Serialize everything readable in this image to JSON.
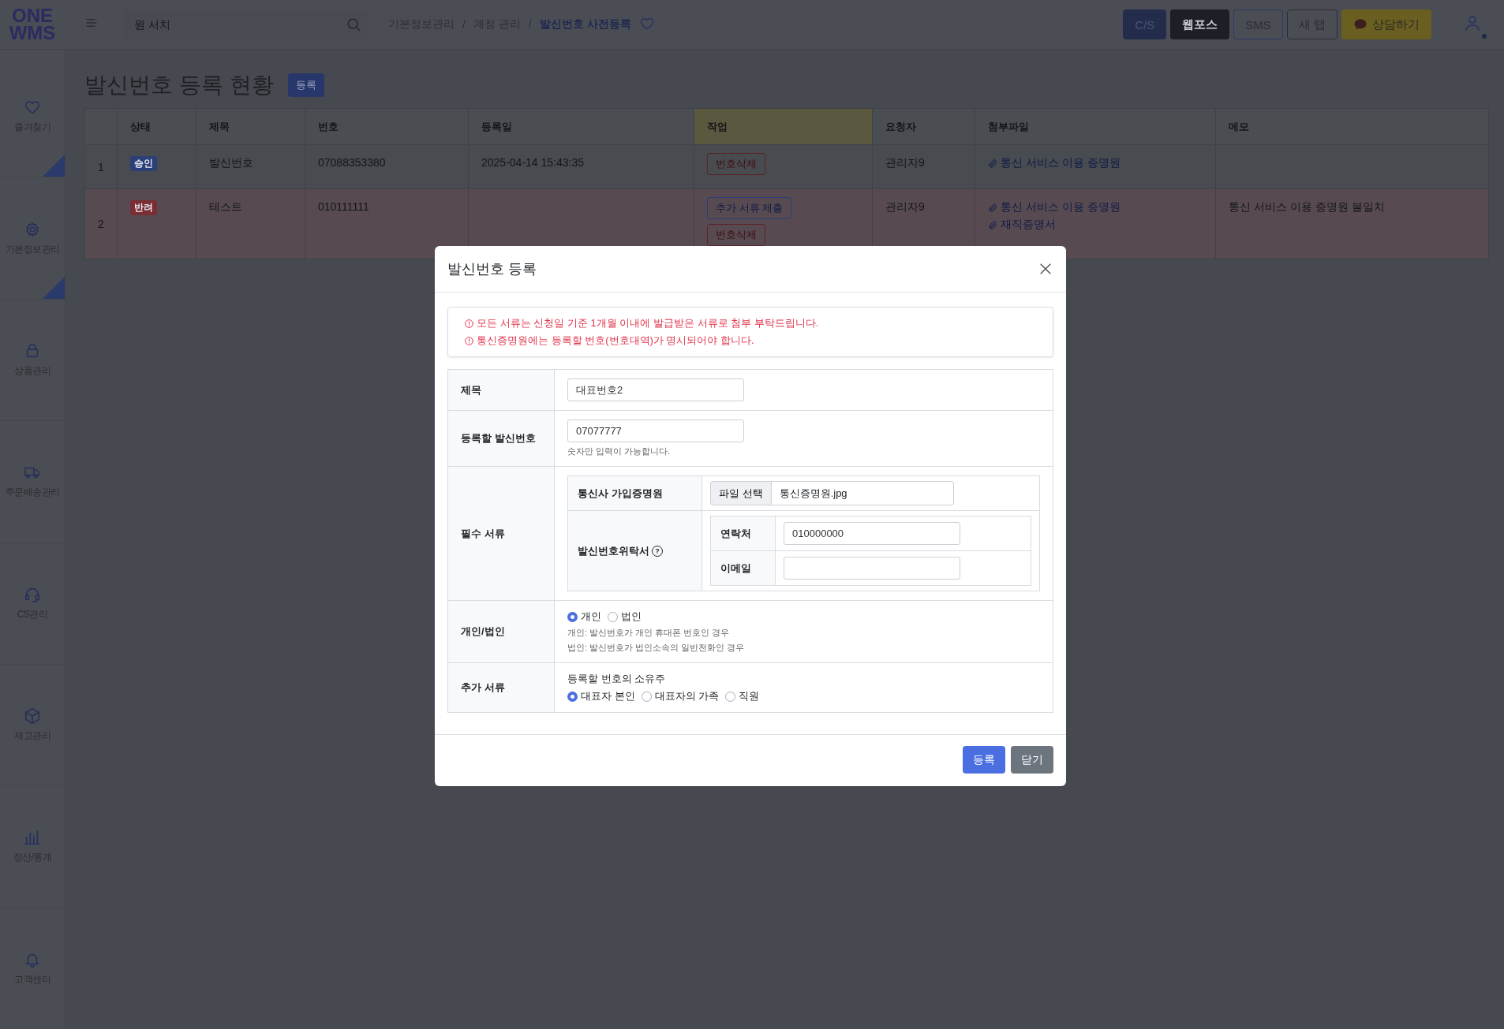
{
  "logo": {
    "line_1": "ONE",
    "line_2": "WMS"
  },
  "search": {
    "placeholder": "원 서치"
  },
  "breadcrumb": [
    {
      "label": "기본정보관리",
      "current": false
    },
    {
      "label": "계정 관리",
      "current": false
    },
    {
      "label": "발신번호 사전등록",
      "current": true
    }
  ],
  "breadcrumb_separator": "/",
  "header_buttons": [
    {
      "label": "C/S",
      "kind": "primary"
    },
    {
      "label": "웹포스",
      "kind": "dark"
    },
    {
      "label": "SMS",
      "kind": "outline"
    },
    {
      "label": "새 탭",
      "kind": "outline_gray"
    },
    {
      "label": "상담하기",
      "kind": "talk"
    }
  ],
  "sidebar": {
    "items": [
      {
        "label": "즐겨찾기",
        "corner_mark": true
      },
      {
        "label": "기본정보관리",
        "corner_mark": true
      },
      {
        "label": "상품관리",
        "corner_mark": false
      },
      {
        "label": "주문배송관리",
        "corner_mark": false
      },
      {
        "label": "CS관리",
        "corner_mark": false
      },
      {
        "label": "재고관리",
        "corner_mark": false
      },
      {
        "label": "정산/통계",
        "corner_mark": false
      },
      {
        "label": "고객센터",
        "corner_mark": false
      }
    ]
  },
  "page": {
    "title": "발신번호 등록 현황",
    "register_button": "등록"
  },
  "table": {
    "columns": [
      {
        "label": "상태",
        "highlighted": false
      },
      {
        "label": "제목",
        "highlighted": false
      },
      {
        "label": "번호",
        "highlighted": false
      },
      {
        "label": "등록일",
        "highlighted": false
      },
      {
        "label": "작업",
        "highlighted": true
      },
      {
        "label": "요청자",
        "highlighted": false
      },
      {
        "label": "첨부파일",
        "highlighted": false
      },
      {
        "label": "메모",
        "highlighted": false
      }
    ],
    "rows": [
      {
        "no": "1",
        "status": "승인",
        "color": "#2b3f78",
        "highlighted": false,
        "title": "발신번호",
        "number": "07088353380",
        "date": "2025-04-14 15:43:35",
        "actions": [
          {
            "label": "번호삭제",
            "kind": "danger"
          }
        ],
        "requester": "관리자9",
        "attachments": [
          "통신 서비스 이용 증명원"
        ]
      },
      {
        "no": "2",
        "status": "반려",
        "color": "#7a2e33",
        "highlighted": true,
        "title": "테스트",
        "number": "010111111",
        "actions": [
          {
            "label": "추가 서류 제출",
            "kind": "primary"
          },
          {
            "label": "번호삭제",
            "kind": "danger"
          }
        ],
        "requester": "관리자9",
        "attachments": [
          "통신 서비스 이용 증명원",
          "재직증명서"
        ],
        "memo": "통신 서비스 이용 증명원 불일치"
      }
    ]
  },
  "modal": {
    "title": "발신번호 등록",
    "notices": [
      "모든 서류는 신청일 기준 1개월 이내에 발급받은 서류로 첨부 부탁드립니다.",
      "통신증명원에는 등록할 번호(번호대역)가 명시되어야 합니다."
    ],
    "form": [
      {
        "kind": "input",
        "label": "제목",
        "value": "대표번호2"
      },
      {
        "kind": "input",
        "label": "등록할 발신번호",
        "value": "07077777",
        "hint": "숫자만 입력이 가능합니다."
      },
      {
        "kind": "documents",
        "label": "필수 서류",
        "documents": [
          {
            "kind": "file",
            "label": "통신사 가입증명원",
            "button": "파일 선택",
            "file_name": "통신증명원.jpg"
          },
          {
            "kind": "contact",
            "label": "발신번호위탁서",
            "help": "?",
            "fields": [
              {
                "label": "연락처",
                "value": "010000000"
              },
              {
                "label": "이메일"
              }
            ]
          }
        ]
      },
      {
        "kind": "radio",
        "label": "개인/법인",
        "options": [
          {
            "label": "개인",
            "selected": true
          },
          {
            "label": "법인",
            "selected": false
          }
        ],
        "notes": [
          "개인: 발신번호가 개인 휴대폰 번호인 경우",
          "법인: 발신번호가 법인소속의 일반전화인 경우"
        ]
      },
      {
        "kind": "radio",
        "label": "추가 서류",
        "caption": "등록할 번호의 소유주",
        "options": [
          {
            "label": "대표자 본인",
            "selected": true
          },
          {
            "label": "대표자의 가족",
            "selected": false
          },
          {
            "label": "직원",
            "selected": false
          }
        ]
      }
    ],
    "buttons": [
      {
        "label": "등록",
        "kind": "primary"
      },
      {
        "label": "닫기",
        "kind": "secondary"
      }
    ]
  }
}
